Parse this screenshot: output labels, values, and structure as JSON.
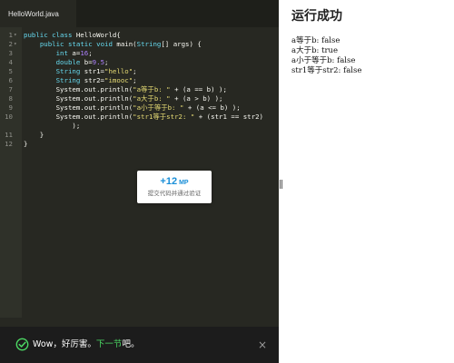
{
  "editor": {
    "tab_label": "HelloWorld.java",
    "lines": [
      {
        "num": "1",
        "fold": "▾",
        "text": "public class HelloWorld{"
      },
      {
        "num": "2",
        "fold": "▾",
        "text": "    public static void main(String[] args) {"
      },
      {
        "num": "3",
        "fold": "",
        "text": "        int a=16;"
      },
      {
        "num": "4",
        "fold": "",
        "text": "        double b=9.5;"
      },
      {
        "num": "5",
        "fold": "",
        "text": "        String str1=\"hello\";"
      },
      {
        "num": "6",
        "fold": "",
        "text": "        String str2=\"imooc\";"
      },
      {
        "num": "7",
        "fold": "",
        "text": "        System.out.println(\"a等于b: \" + (a == b) );"
      },
      {
        "num": "8",
        "fold": "",
        "text": "        System.out.println(\"a大于b: \" + (a > b) );"
      },
      {
        "num": "9",
        "fold": "",
        "text": "        System.out.println(\"a小于等于b: \" + (a <= b) );"
      },
      {
        "num": "10",
        "fold": "",
        "text": "        System.out.println(\"str1等于str2: \" + (str1 == str2)"
      },
      {
        "num": "",
        "fold": "",
        "text": "            );"
      },
      {
        "num": "11",
        "fold": "",
        "text": "    }"
      },
      {
        "num": "12",
        "fold": "",
        "text": "}"
      }
    ]
  },
  "score_card": {
    "value": "+12",
    "unit": "MP",
    "caption": "提交代码并通过验证"
  },
  "toast": {
    "message": "Wow，好厉害。",
    "next_link": "下一节",
    "suffix": "吧。",
    "close_symbol": "×"
  },
  "output": {
    "title": "运行成功",
    "lines": [
      "a等于b: false",
      "a大于b: true",
      "a小于等于b: false",
      "str1等于str2: false"
    ]
  },
  "colors": {
    "editor_bg": "#272822",
    "keyword": "#66d9ef",
    "string": "#e6db74",
    "number": "#ae81ff",
    "operator": "#f92672",
    "success_green": "#4cd964",
    "score_blue": "#1a8fd8"
  },
  "icons": {
    "toast": "check-circle-icon",
    "close": "close-icon"
  }
}
